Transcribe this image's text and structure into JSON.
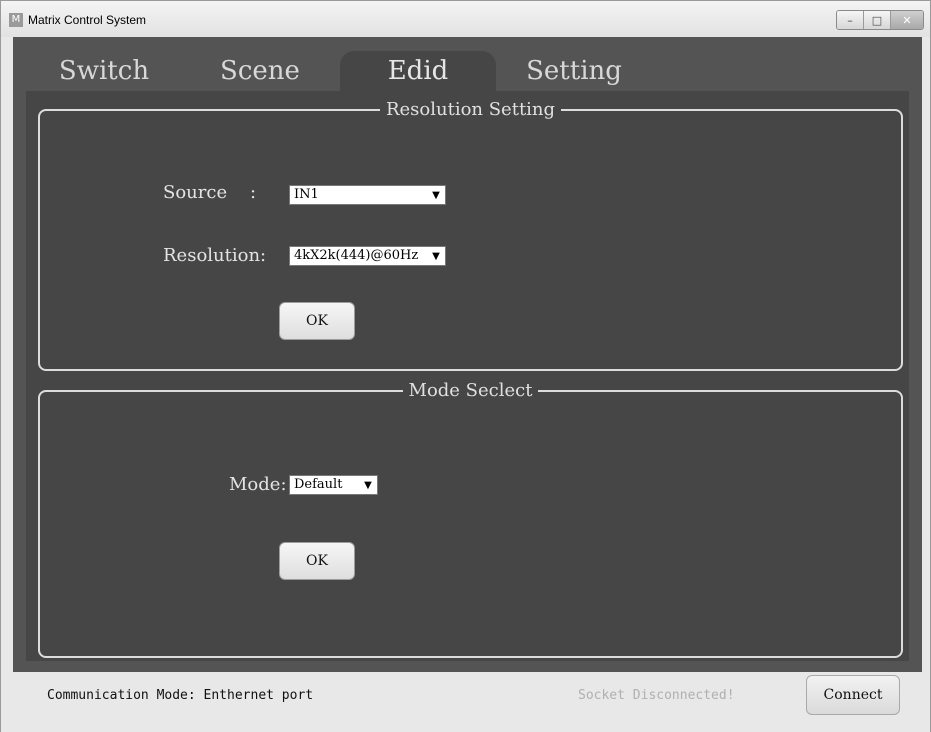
{
  "window": {
    "title": "Matrix Control System",
    "app_icon": "M",
    "controls": {
      "minimize": "–",
      "maximize": "□",
      "close": "✕"
    }
  },
  "tabs": [
    {
      "label": "Switch",
      "active": false
    },
    {
      "label": "Scene",
      "active": false
    },
    {
      "label": "Edid",
      "active": true
    },
    {
      "label": "Setting",
      "active": false
    }
  ],
  "resolution_setting": {
    "legend": "Resolution  Setting",
    "source_label": "Source    :",
    "source_value": "IN1",
    "resolution_label": "Resolution:",
    "resolution_value": "4kX2k(444)@60Hz",
    "ok_label": "OK"
  },
  "mode_select": {
    "legend": "Mode Seclect",
    "mode_label": "Mode:",
    "mode_value": "Default",
    "ok_label": "OK"
  },
  "statusbar": {
    "communication_mode": "Communication Mode: Enthernet port",
    "socket_status": "Socket Disconnected!",
    "connect_label": "Connect"
  },
  "colors": {
    "frame": "#545454",
    "content": "#464646",
    "group_border": "#dcdcdc",
    "status_inactive": "#b0b0b0"
  },
  "icons": {
    "dropdown": "▼"
  }
}
